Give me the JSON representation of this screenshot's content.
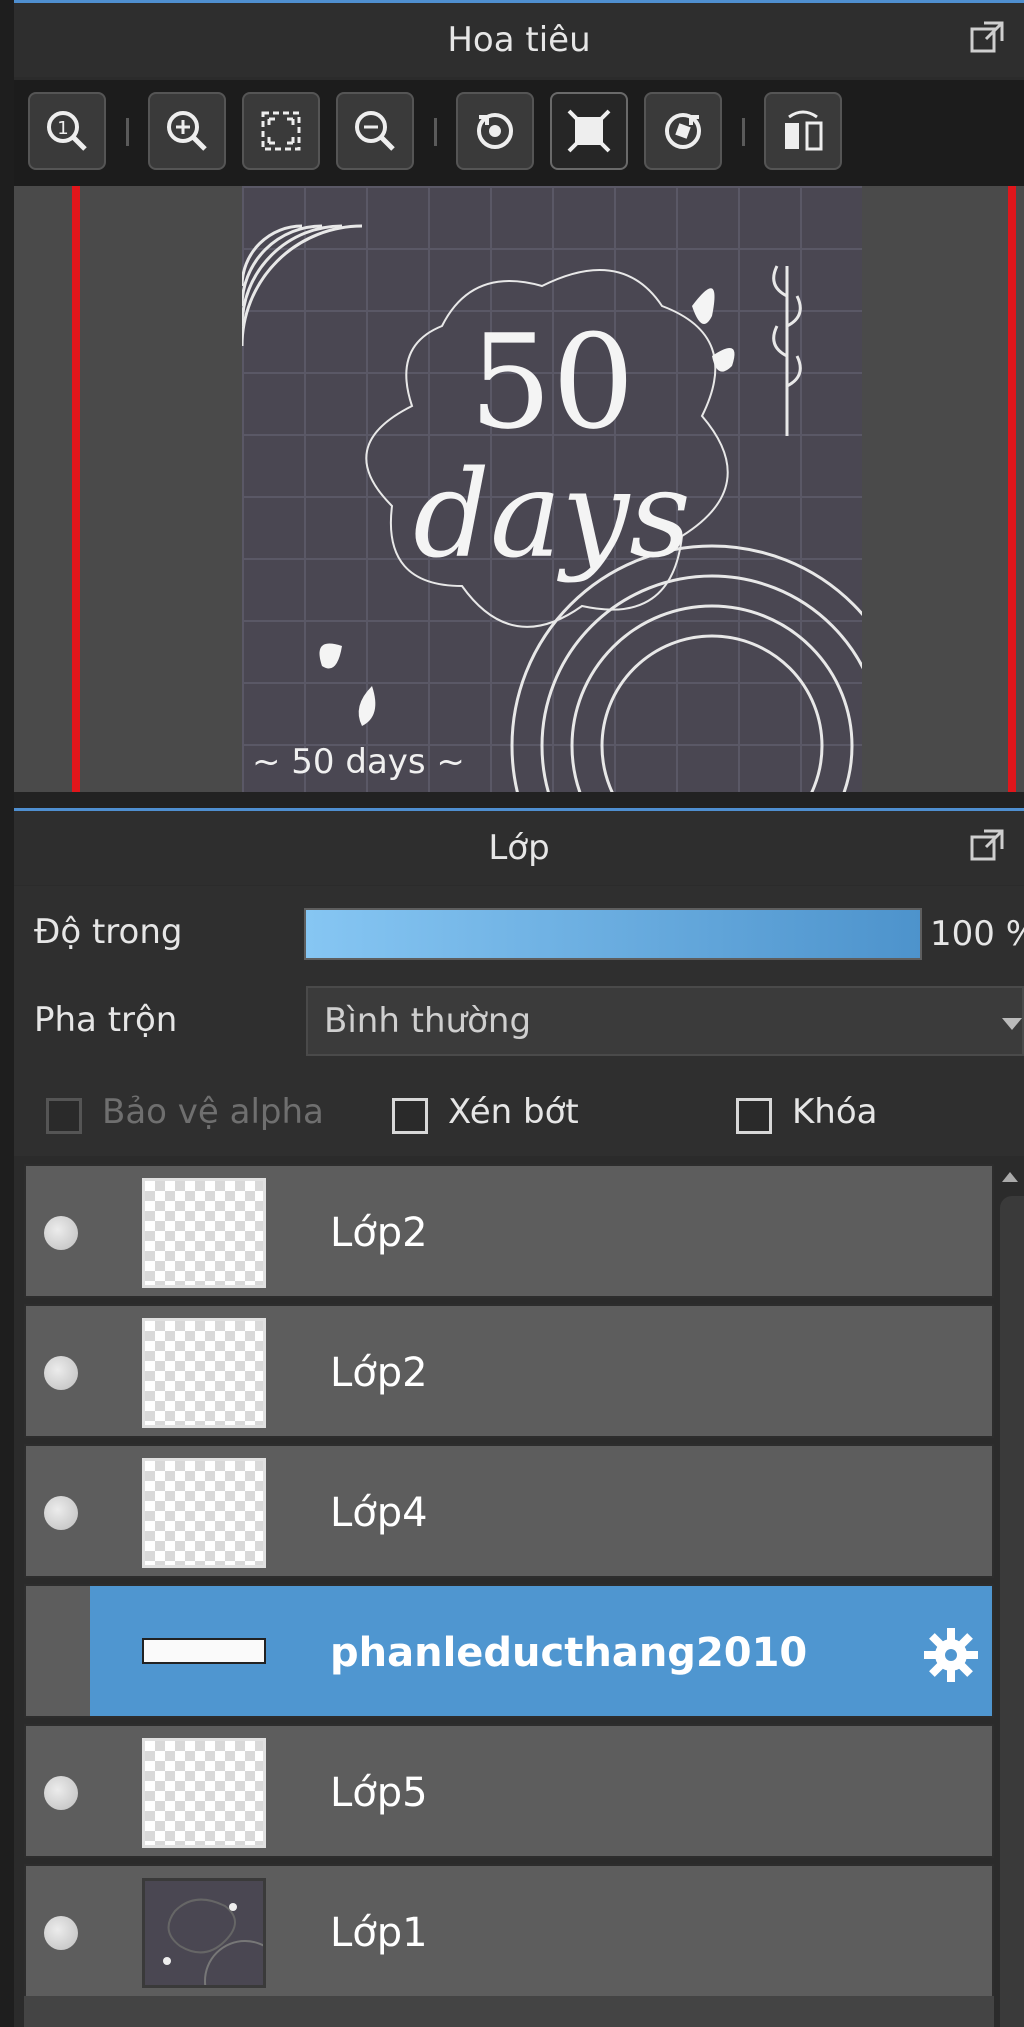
{
  "navigator": {
    "title": "Hoa tiêu",
    "toolbar": [
      {
        "icon": "zoom-actual-icon"
      },
      {
        "icon": "zoom-in-icon"
      },
      {
        "icon": "fit-screen-icon"
      },
      {
        "icon": "zoom-out-icon"
      },
      {
        "icon": "rotate-left-icon"
      },
      {
        "icon": "reset-view-icon"
      },
      {
        "icon": "rotate-right-icon"
      },
      {
        "icon": "flip-horizontal-icon"
      }
    ],
    "canvas": {
      "big_number": "50",
      "big_word": "days",
      "footer_text": "~ 50 days ~"
    }
  },
  "layers": {
    "title": "Lớp",
    "opacity_label": "Độ trong",
    "opacity_value": "100 %",
    "opacity_percent": 100,
    "blend_label": "Pha trộn",
    "blend_value": "Bình thường",
    "protect_alpha_label": "Bảo vệ alpha",
    "clipping_label": "Xén bớt",
    "lock_label": "Khóa",
    "items": [
      {
        "name": "Lớp2",
        "visible": true,
        "thumb": "transparent"
      },
      {
        "name": "Lớp2",
        "visible": true,
        "thumb": "transparent"
      },
      {
        "name": "Lớp4",
        "visible": true,
        "thumb": "transparent"
      },
      {
        "name": "phanleducthang2010",
        "visible": false,
        "thumb": "text",
        "selected": true
      },
      {
        "name": "Lớp5",
        "visible": true,
        "thumb": "transparent"
      },
      {
        "name": "Lớp1",
        "visible": true,
        "thumb": "artwork"
      }
    ]
  },
  "colors": {
    "accent": "#4f96d0",
    "guide_red": "#e0161b",
    "panel_bg": "#2b2b2b"
  }
}
